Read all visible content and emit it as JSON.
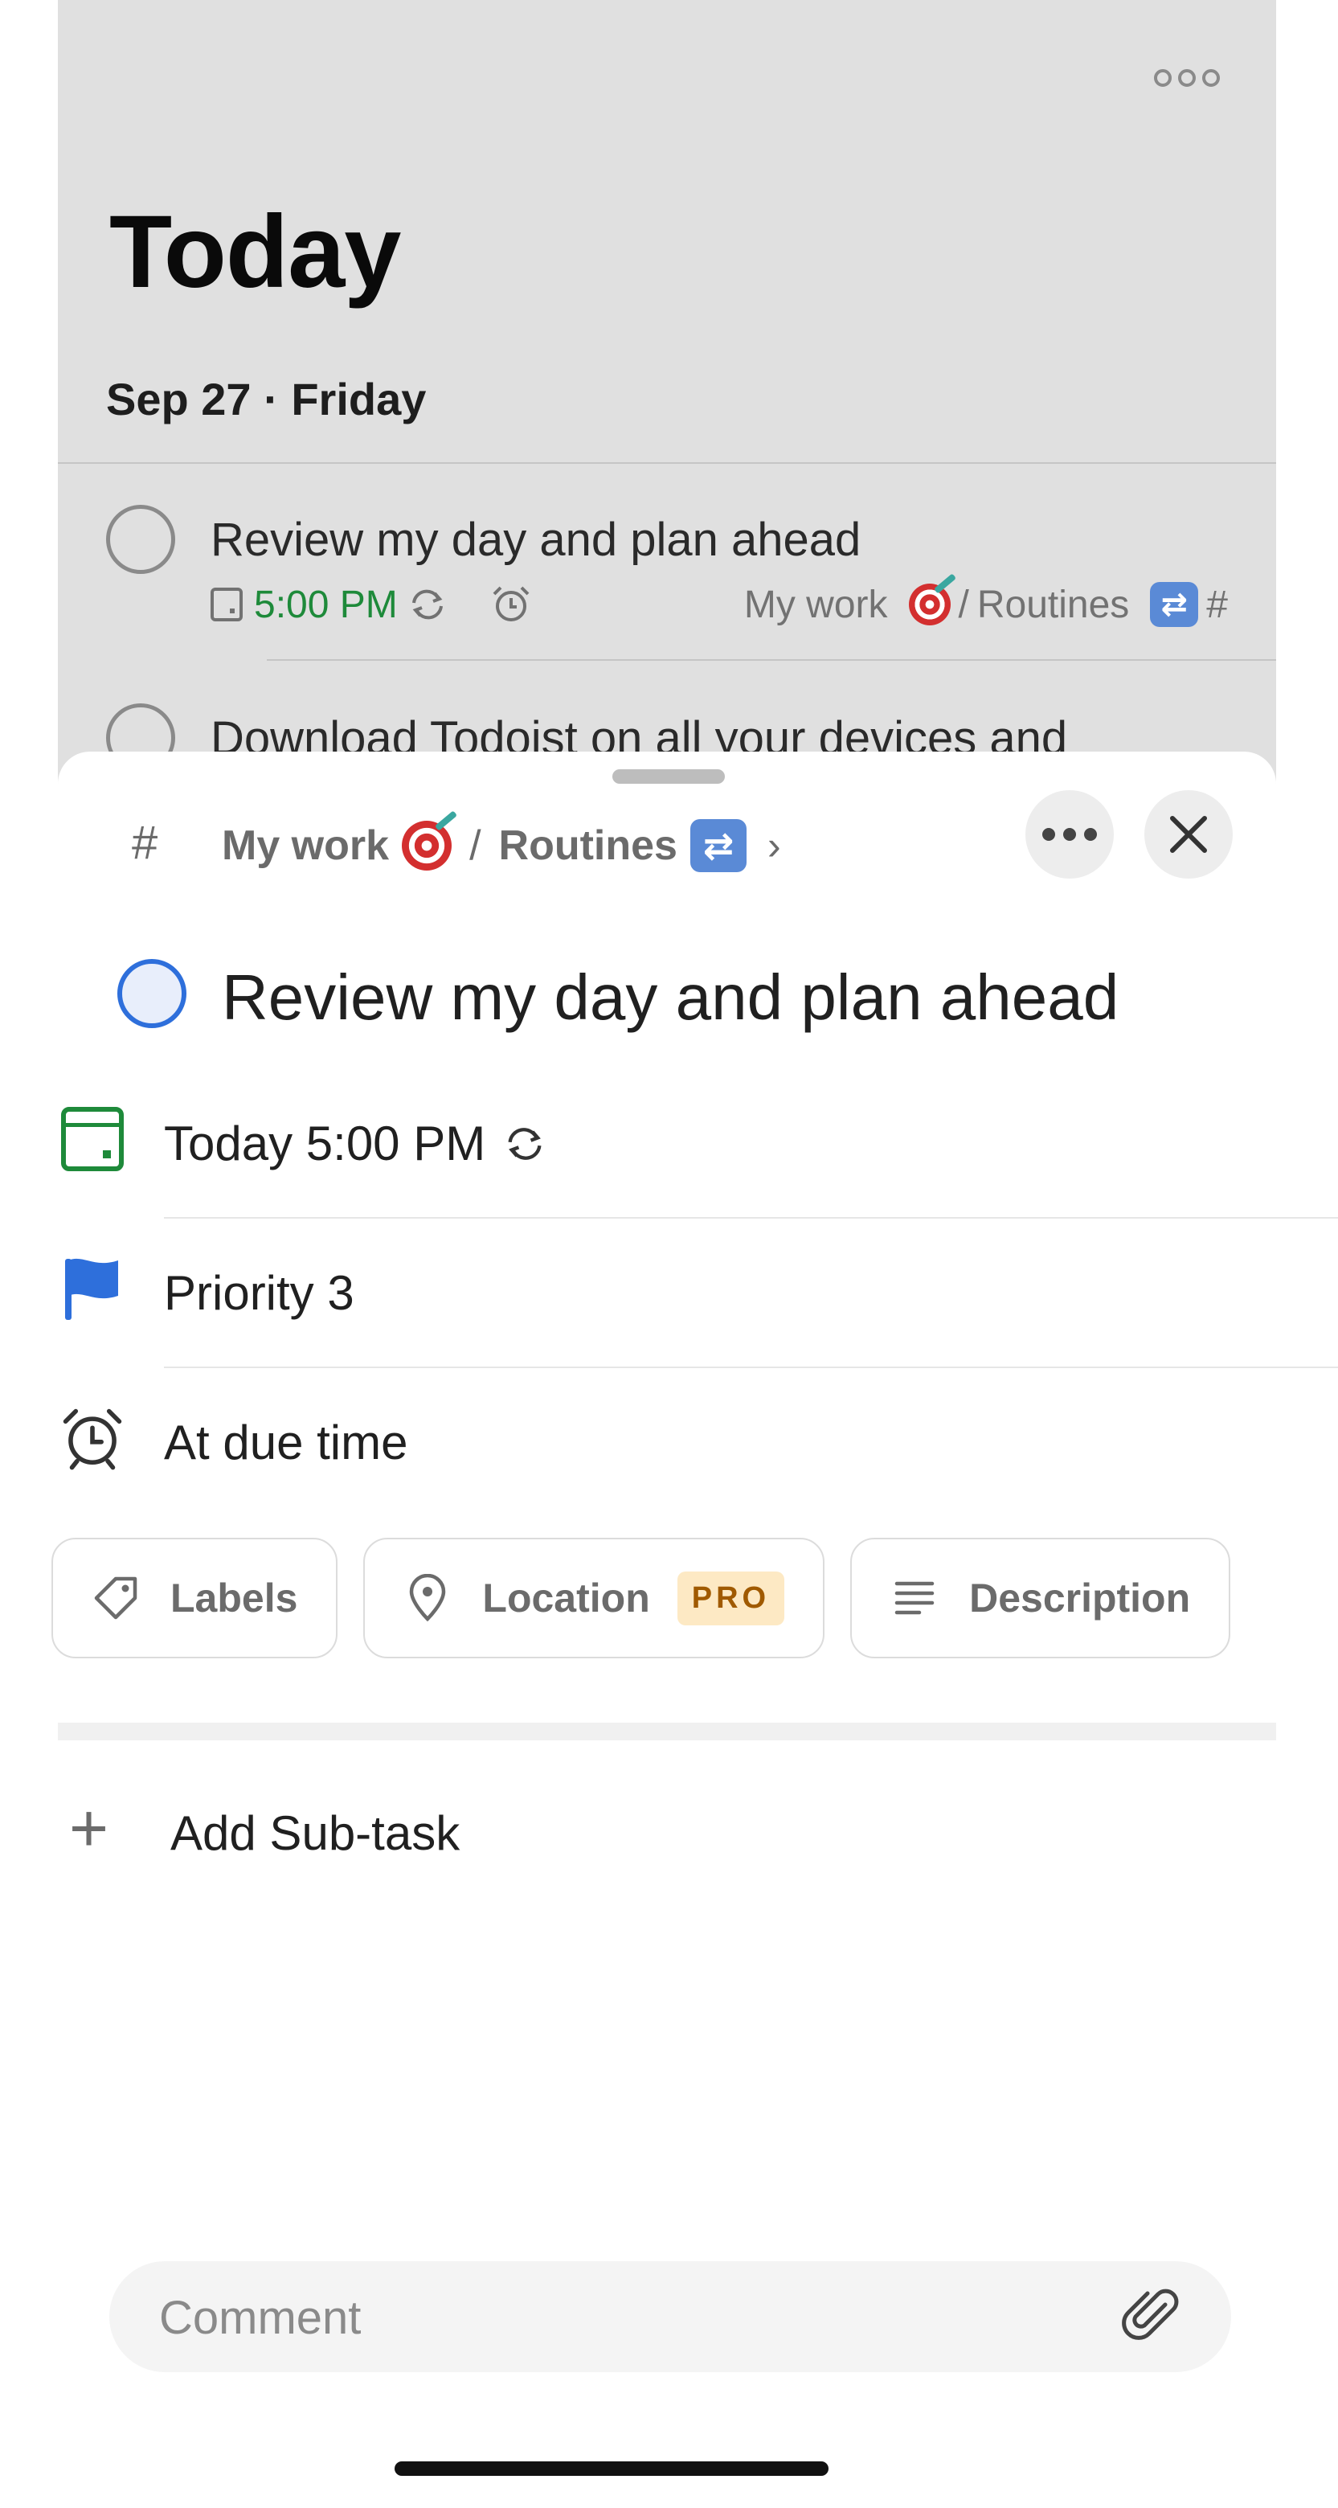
{
  "background": {
    "page_title": "Today",
    "date_heading": "Sep 27 · Friday",
    "tasks": [
      {
        "title": "Review my day and plan ahead",
        "time": "5:00 PM",
        "project": "My work",
        "section": "Routines",
        "separator": "/",
        "hash": "#"
      },
      {
        "title": "Download Todoist on all your devices and"
      }
    ]
  },
  "sheet": {
    "breadcrumb": {
      "hash": "#",
      "project": "My work",
      "separator": "/",
      "section": "Routines",
      "chevron": "›"
    },
    "task_title": "Review my day and plan ahead",
    "fields": {
      "date": "Today 5:00 PM",
      "priority": "Priority 3",
      "reminder": "At due time"
    },
    "chips": {
      "labels": "Labels",
      "location": "Location",
      "pro_badge": "PRO",
      "description": "Description"
    },
    "add_subtask": "Add Sub-task",
    "comment": {
      "placeholder": "Comment"
    }
  },
  "colors": {
    "accent_blue": "#2e6fdb",
    "date_green": "#1e8a3a",
    "pro_badge_bg": "#fde9c4",
    "pro_badge_text": "#a05a00",
    "backdrop": "#e0e0e0"
  },
  "icons": [
    "more-horizontal-icon",
    "calendar-icon",
    "repeat-icon",
    "alarm-icon",
    "hash-icon",
    "target-emoji-icon",
    "repeat-emoji-icon",
    "chevron-right-icon",
    "close-icon",
    "flag-icon",
    "tag-icon",
    "location-pin-icon",
    "description-lines-icon",
    "plus-icon",
    "paperclip-icon"
  ]
}
